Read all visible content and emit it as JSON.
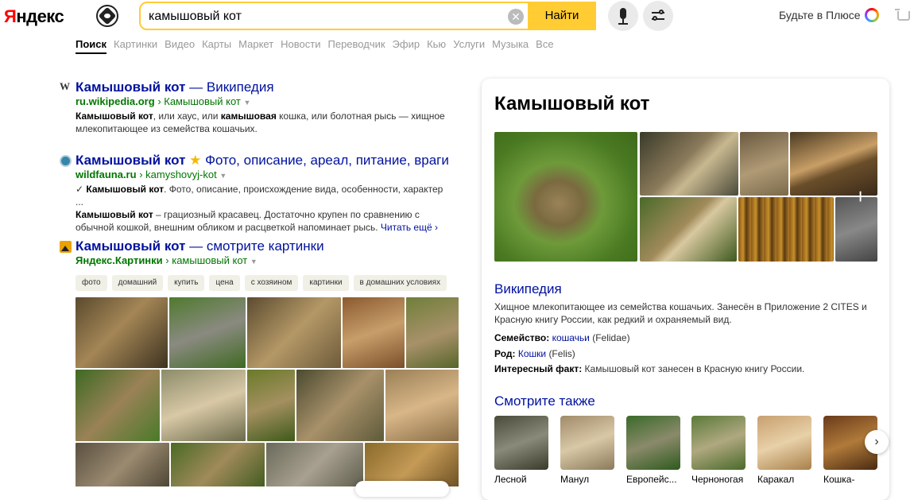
{
  "header": {
    "logo": "Яндекс",
    "search_value": "камышовый кот",
    "find_label": "Найти",
    "clear_glyph": "✕",
    "plus_text": "Будьте в Плюсе"
  },
  "tabs": [
    "Поиск",
    "Картинки",
    "Видео",
    "Карты",
    "Маркет",
    "Новости",
    "Переводчик",
    "Эфир",
    "Кью",
    "Услуги",
    "Музыка",
    "Все"
  ],
  "results": {
    "wiki": {
      "favicon": "W",
      "title_bold": "Камышовый кот",
      "title_rest": " — Википедия",
      "url_domain": "ru.wikipedia.org",
      "url_path": "› Камышовый кот",
      "arrow": "▼",
      "snip_b1": "Камышовый кот",
      "snip_t1": ", или хаус, или ",
      "snip_b2": "камышовая",
      "snip_t2": " кошка, или болотная рысь — хищное млекопитающее из семейства кошачьих."
    },
    "wildfauna": {
      "title_bold": "Камышовый кот",
      "star": "★",
      "title_rest": " Фото, описание, ареал, питание, враги",
      "url_domain": "wildfauna.ru",
      "url_path": "› kamyshovyj-kot",
      "arrow": "▼",
      "check": "✓",
      "snip_b1": "Камышовый кот",
      "snip_t1": ". Фото, описание, происхождение вида, особенности, характер ...",
      "snip_b2": "Камышовый кот",
      "snip_t2": " – грациозный красавец. Достаточно крупен по сравнению с обычной кошкой, внешним обликом и расцветкой напоминает рысь. ",
      "more": "Читать ещё ›"
    },
    "images": {
      "title_bold": "Камышовый кот",
      "title_rest": " — смотрите картинки",
      "url_domain": "Яндекс.Картинки",
      "url_path": "› камышовый кот",
      "arrow": "▼",
      "chips": [
        "фото",
        "домашний",
        "купить",
        "цена",
        "с хозяином",
        "картинки",
        "в домашних условиях"
      ]
    }
  },
  "card": {
    "title": "Камышовый кот",
    "photo_plus": "+",
    "wiki_title": "Википедия",
    "wiki_desc": "Хищное млекопитающее из семейства кошачьих. Занесён в Приложение 2 CITES и Красную книгу России, как редкий и охраняемый вид.",
    "family_label": "Семейство:",
    "family_link": "кошачьи",
    "family_latin": "(Felidae)",
    "genus_label": "Род:",
    "genus_link": "Кошки",
    "genus_latin": "(Felis)",
    "fact_label": "Интересный факт:",
    "fact_text": "Камышовый кот занесен в Красную книгу России.",
    "also_title": "Смотрите также",
    "also": [
      "Лесной",
      "Манул",
      "Европейс...",
      "Черноногая",
      "Каракал",
      "Кошка-"
    ],
    "next_glyph": "›"
  }
}
